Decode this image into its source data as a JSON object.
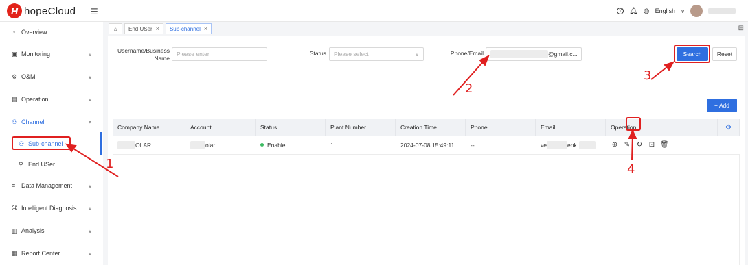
{
  "header": {
    "logo_letter": "H",
    "app_name": "hopeCloud",
    "menu_icon": "menu-fold-icon",
    "help_icon": "?",
    "language": "English"
  },
  "sidebar": {
    "items": [
      {
        "label": "Overview",
        "icon": "dashboard-icon",
        "glyph": "◔"
      },
      {
        "label": "Monitoring",
        "icon": "monitor-icon",
        "glyph": "▣"
      },
      {
        "label": "O&M",
        "icon": "maintenance-icon",
        "glyph": "⚙"
      },
      {
        "label": "Operation",
        "icon": "operation-icon",
        "glyph": "▤"
      },
      {
        "label": "Channel",
        "icon": "channel-icon",
        "glyph": "⚇"
      },
      {
        "label": "Sub-channel",
        "icon": "sub-channel-icon",
        "glyph": "⚇"
      },
      {
        "label": "End USer",
        "icon": "end-user-icon",
        "glyph": "⚲"
      },
      {
        "label": "Data Management",
        "icon": "database-icon",
        "glyph": "≡"
      },
      {
        "label": "Intelligent Diagnosis",
        "icon": "diagnosis-icon",
        "glyph": "⌘"
      },
      {
        "label": "Analysis",
        "icon": "analysis-icon",
        "glyph": "▥"
      },
      {
        "label": "Report Center",
        "icon": "report-icon",
        "glyph": "▦"
      }
    ]
  },
  "tabs": [
    {
      "label": "End USer"
    },
    {
      "label": "Sub-channel"
    }
  ],
  "filters": {
    "username_label": "Username/Business Name",
    "username_placeholder": "Please enter",
    "status_label": "Status",
    "status_placeholder": "Please select",
    "phone_email_label": "Phone/Email",
    "phone_email_value_suffix": "@gmail.c...",
    "search_label": "Search",
    "reset_label": "Reset",
    "add_label": "+ Add"
  },
  "table": {
    "columns": [
      "Company Name",
      "Account",
      "Status",
      "Plant Number",
      "Creation Time",
      "Phone",
      "Email",
      "Operation"
    ],
    "rows": [
      {
        "company_suffix": "OLAR",
        "account_suffix": "olar",
        "status": "Enable",
        "plant_number": "1",
        "creation_time": "2024-07-08 15:49:11",
        "phone": "--",
        "email_prefix": "ve",
        "email_mid": "enk"
      }
    ]
  },
  "colors": {
    "accent": "#2f6fe0",
    "annotation": "#e02020",
    "status_enable": "#3dbb63"
  },
  "annotations": [
    "1",
    "2",
    "3",
    "4"
  ]
}
